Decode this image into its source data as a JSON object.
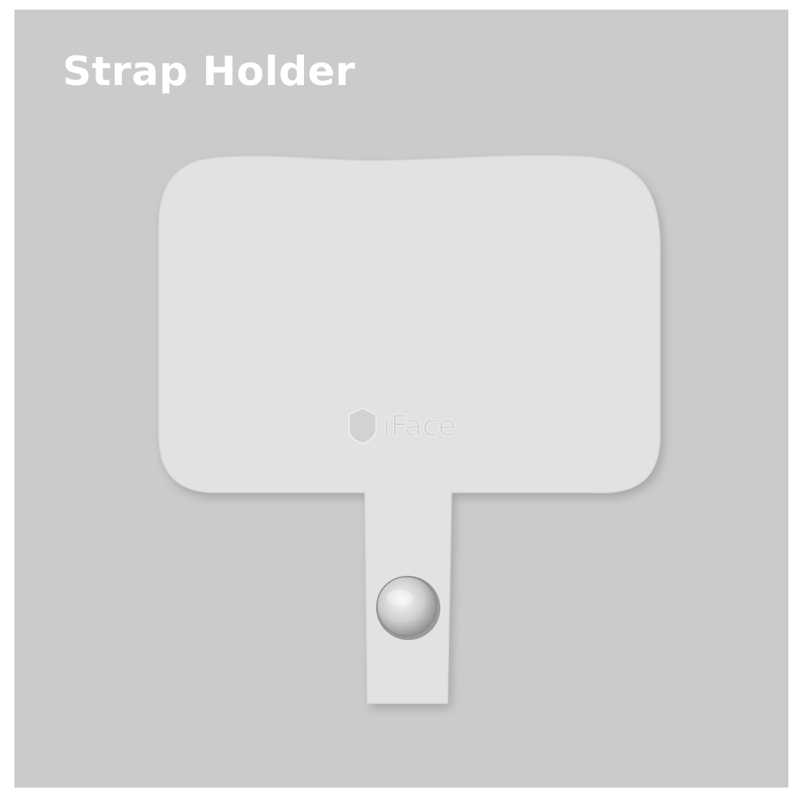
{
  "title": "Strap Holder",
  "product": {
    "brand_text": "iFace"
  },
  "colors": {
    "background": "#cbcbcb",
    "title": "#ffffff",
    "holder": "#e2e2e2",
    "logo": "#d2d2d2"
  },
  "icons": {
    "brand_logo": "shield-logo-icon",
    "snap_button": "metal-snap-button-icon"
  }
}
